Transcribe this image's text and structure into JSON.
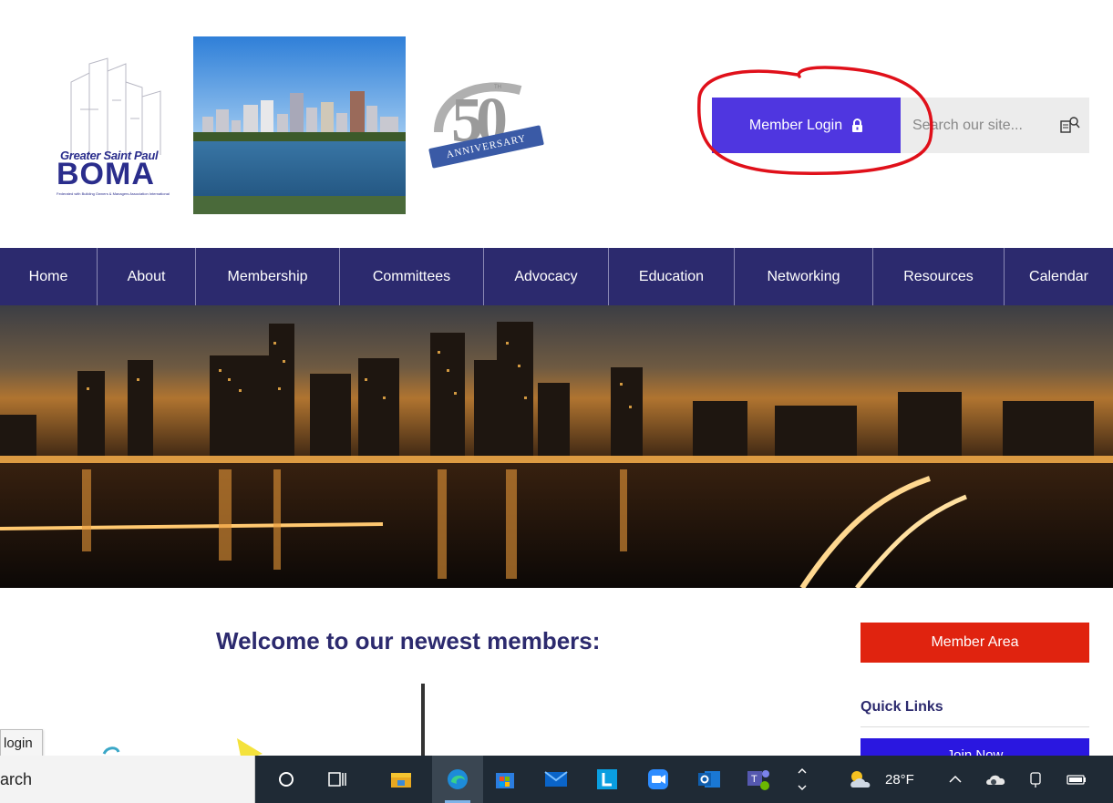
{
  "header": {
    "boma_logo": {
      "line1": "Greater Saint Paul",
      "line2": "BOMA",
      "line3": "Federated with Building Owners & Managers Association International"
    },
    "anniversary_logo": {
      "number": "50",
      "suffix": "TH",
      "ribbon": "ANNIVERSARY"
    },
    "member_login_label": "Member Login",
    "search_placeholder": "Search our site...",
    "accent_color": "#4f36e0",
    "annotation_color": "#e0101a"
  },
  "nav": {
    "items": [
      {
        "label": "Home"
      },
      {
        "label": "About"
      },
      {
        "label": "Membership"
      },
      {
        "label": "Committees"
      },
      {
        "label": "Advocacy"
      },
      {
        "label": "Education"
      },
      {
        "label": "Networking"
      },
      {
        "label": "Resources"
      },
      {
        "label": "Calendar"
      }
    ],
    "background": "#2c2a6e"
  },
  "main": {
    "welcome_heading": "Welcome to our newest members:",
    "member_area_label": "Member Area",
    "quick_links_heading": "Quick Links",
    "join_now_label": "Join Now"
  },
  "tooltip": {
    "text": "login"
  },
  "taskbar": {
    "search_text": "arch",
    "weather_temp": "28°F",
    "icons": [
      "cortana-icon",
      "task-view-icon",
      "file-explorer-icon",
      "edge-icon",
      "store-icon",
      "mail-icon",
      "l-app-icon",
      "zoom-icon",
      "outlook-icon",
      "teams-icon",
      "chevron-icon",
      "weather-icon",
      "tray-up-icon",
      "onedrive-icon",
      "network-icon",
      "battery-icon"
    ]
  }
}
